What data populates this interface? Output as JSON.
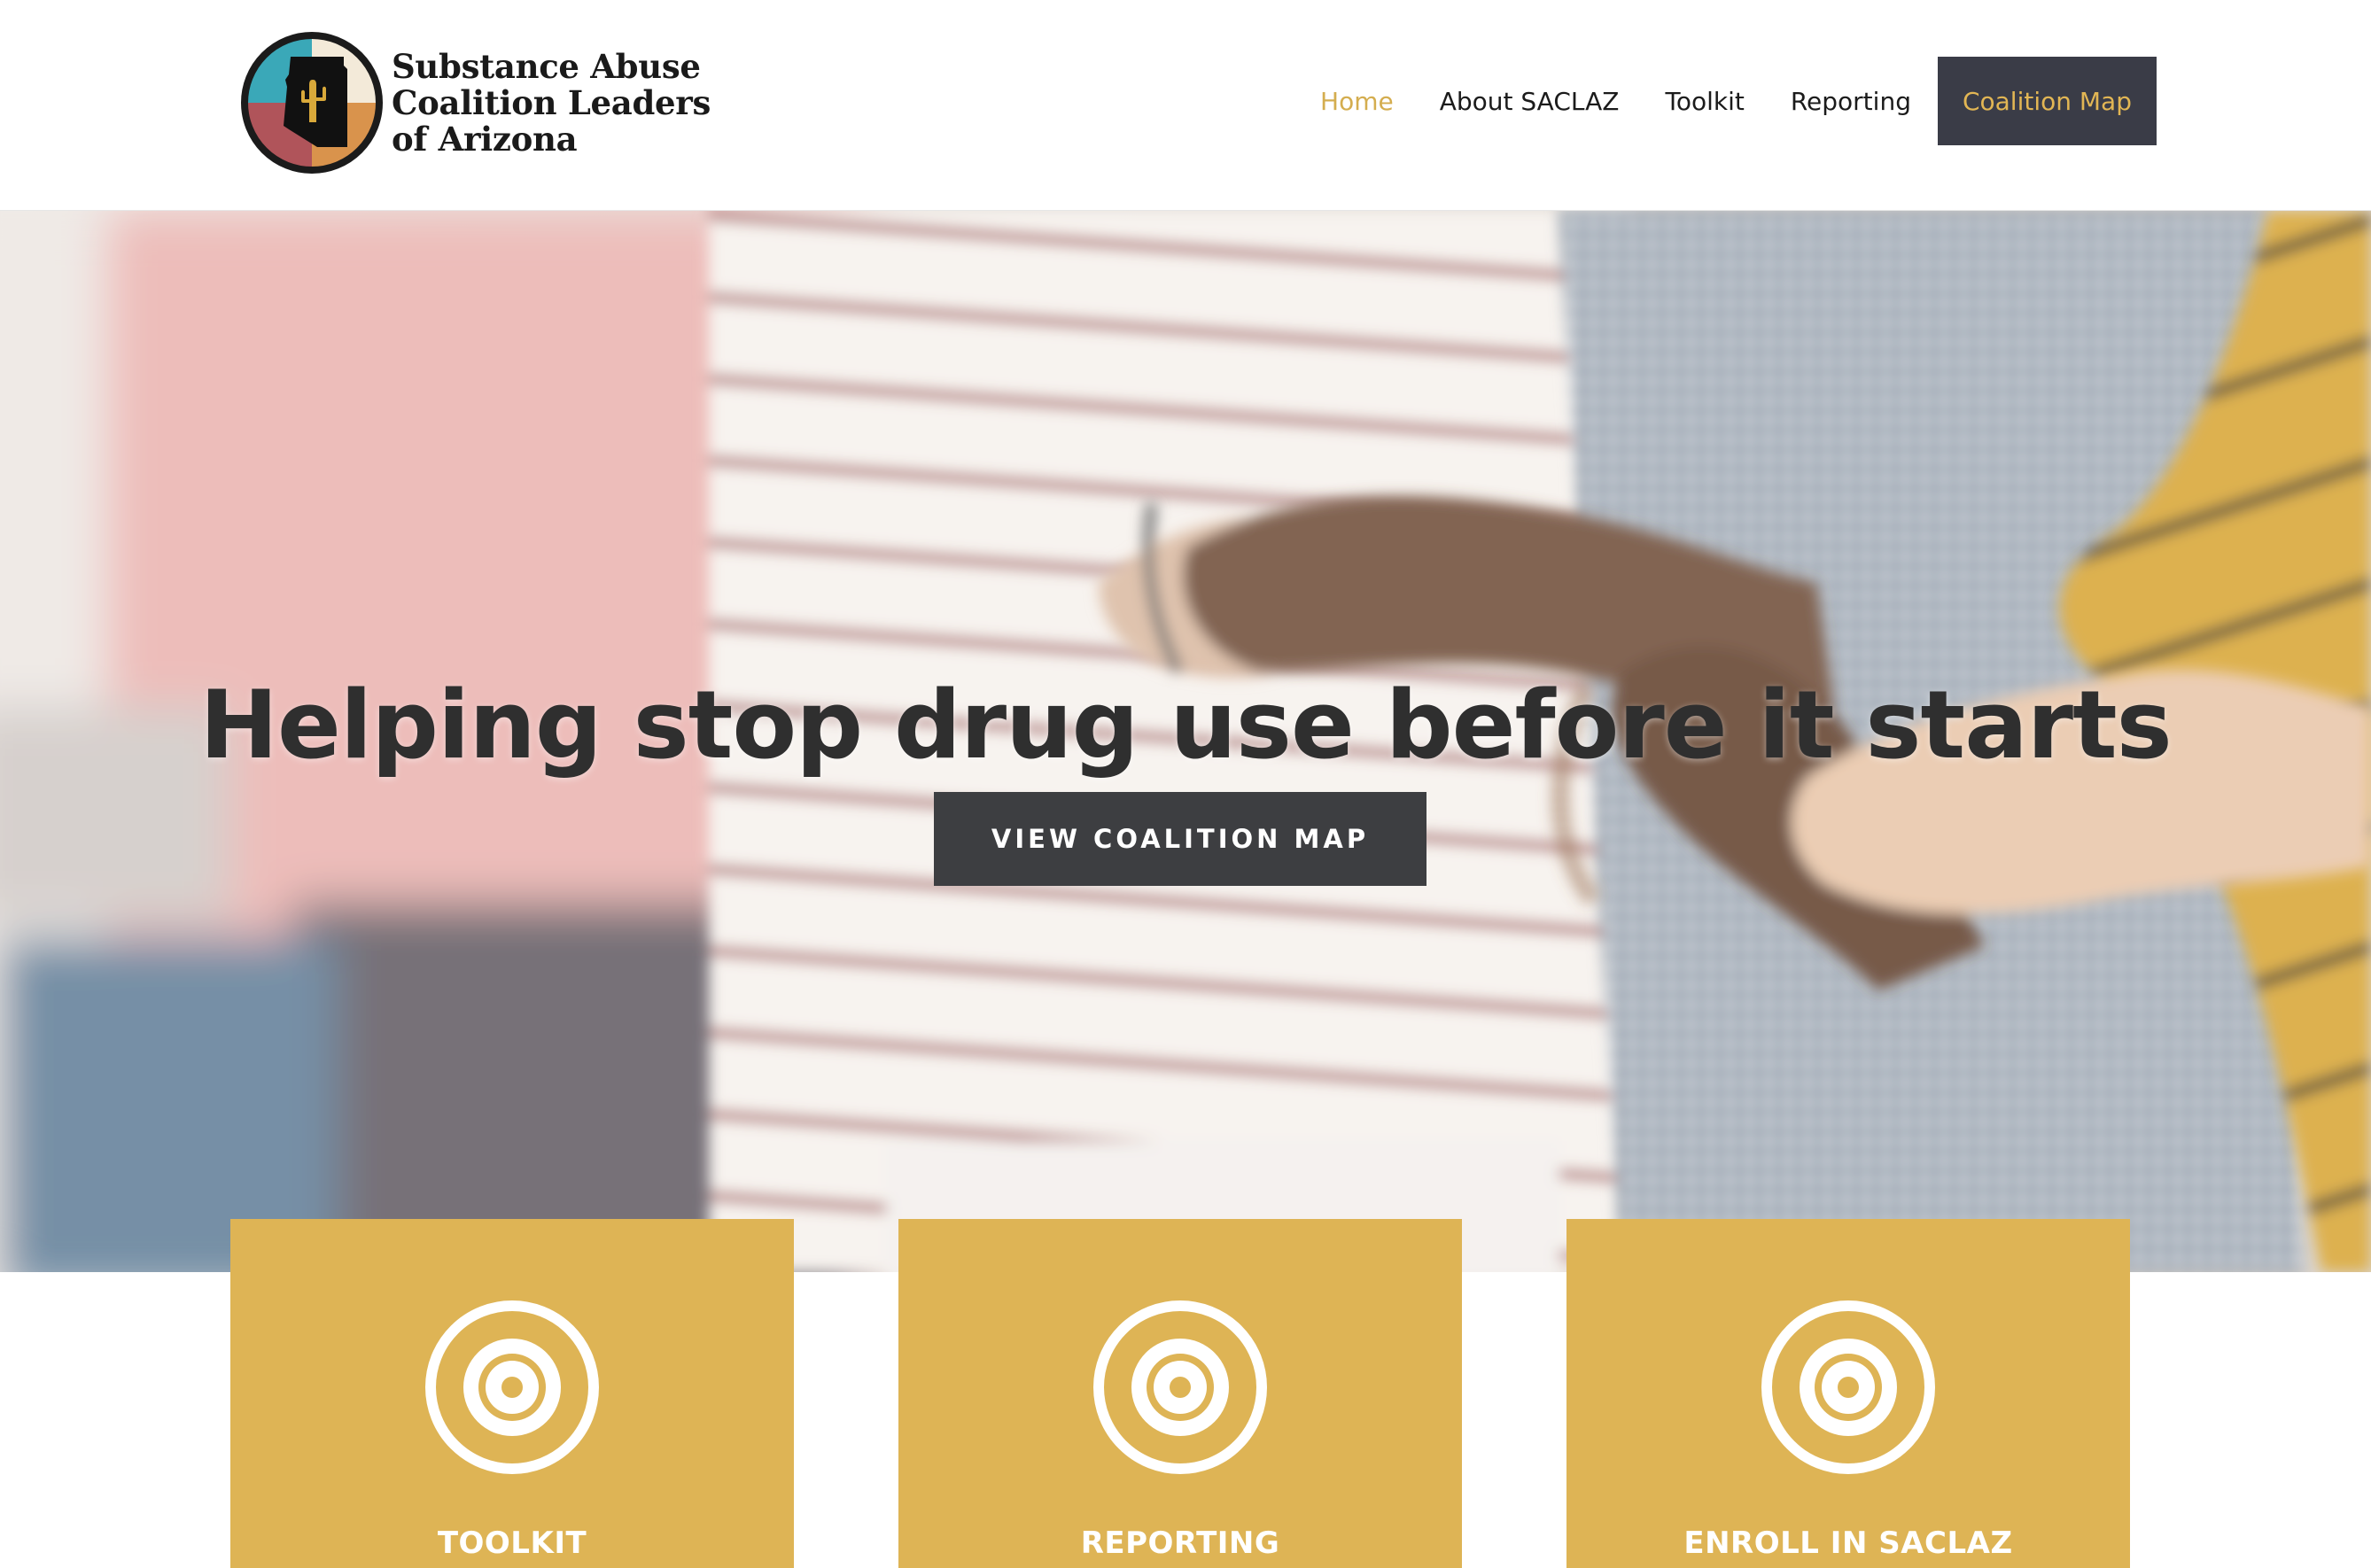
{
  "header": {
    "logo": {
      "line1": "Substance Abuse",
      "line2": "Coalition Leaders",
      "line3": "of Arizona",
      "icon": "arizona-cactus-logo-icon"
    },
    "nav": {
      "home": "Home",
      "about": "About SACLAZ",
      "toolkit": "Toolkit",
      "reporting": "Reporting",
      "coalition_map": "Coalition Map"
    }
  },
  "hero": {
    "title": "Helping stop drug use before it starts",
    "button_label": "VIEW COALITION MAP",
    "image": "people-holding-arms-photo"
  },
  "cards": [
    {
      "label": "TOOLKIT",
      "icon": "target-icon"
    },
    {
      "label": "REPORTING",
      "icon": "target-icon"
    },
    {
      "label": "ENROLL IN SACLAZ",
      "icon": "target-icon"
    }
  ],
  "colors": {
    "accent_gold": "#deb455",
    "nav_active": "#d4ad4f",
    "dark_button": "#3d3e41",
    "nav_cta_bg": "#3a3c47",
    "nav_cta_text": "#e2b654",
    "heading_text": "#2f2f2f"
  }
}
